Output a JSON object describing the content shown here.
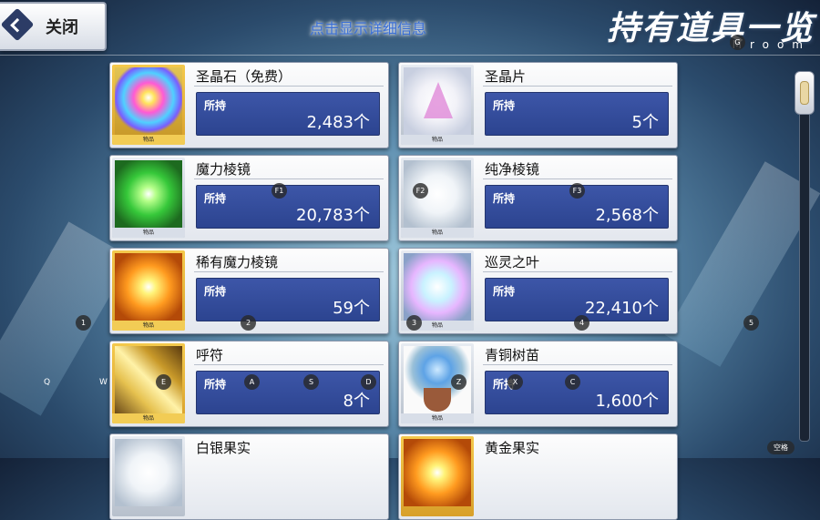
{
  "header": {
    "close_label": "关闭",
    "hint": "点击显示详细信息",
    "title": "持有道具一览",
    "subtitle": "Mroom"
  },
  "held_label": "所持",
  "thumb_tag": "物品",
  "items": [
    {
      "name": "圣晶石（免费）",
      "count": "2,483个",
      "art": "rainbow-star-crystal",
      "frame": "gold"
    },
    {
      "name": "圣晶片",
      "count": "5个",
      "art": "rainbow-prism-fragment",
      "frame": "silver"
    },
    {
      "name": "魔力棱镜",
      "count": "20,783个",
      "art": "green-cube",
      "frame": "silver"
    },
    {
      "name": "纯净棱镜",
      "count": "2,568个",
      "art": "white-cube",
      "frame": "silver"
    },
    {
      "name": "稀有魔力棱镜",
      "count": "59个",
      "art": "orange-cube",
      "frame": "gold"
    },
    {
      "name": "巡灵之叶",
      "count": "22,410个",
      "art": "crystal-leaf",
      "frame": "silver"
    },
    {
      "name": "呼符",
      "count": "8个",
      "art": "gold-talisman",
      "frame": "gold"
    },
    {
      "name": "青铜树苗",
      "count": "1,600个",
      "art": "bronze-sapling",
      "frame": "silver"
    },
    {
      "name": "白银果实",
      "count": "",
      "art": "silver-fruit",
      "frame": "silver"
    },
    {
      "name": "黄金果实",
      "count": "",
      "art": "gold-fruit",
      "frame": "gold"
    }
  ],
  "key_hints": {
    "g": "G",
    "f1": "F1",
    "f2": "F2",
    "f3": "F3",
    "k1": "1",
    "k2": "2",
    "k3": "3",
    "k4": "4",
    "k5": "5",
    "q": "Q",
    "w": "W",
    "e": "E",
    "a": "A",
    "s": "S",
    "d": "D",
    "z": "Z",
    "x": "X",
    "c": "C",
    "space": "空格"
  }
}
